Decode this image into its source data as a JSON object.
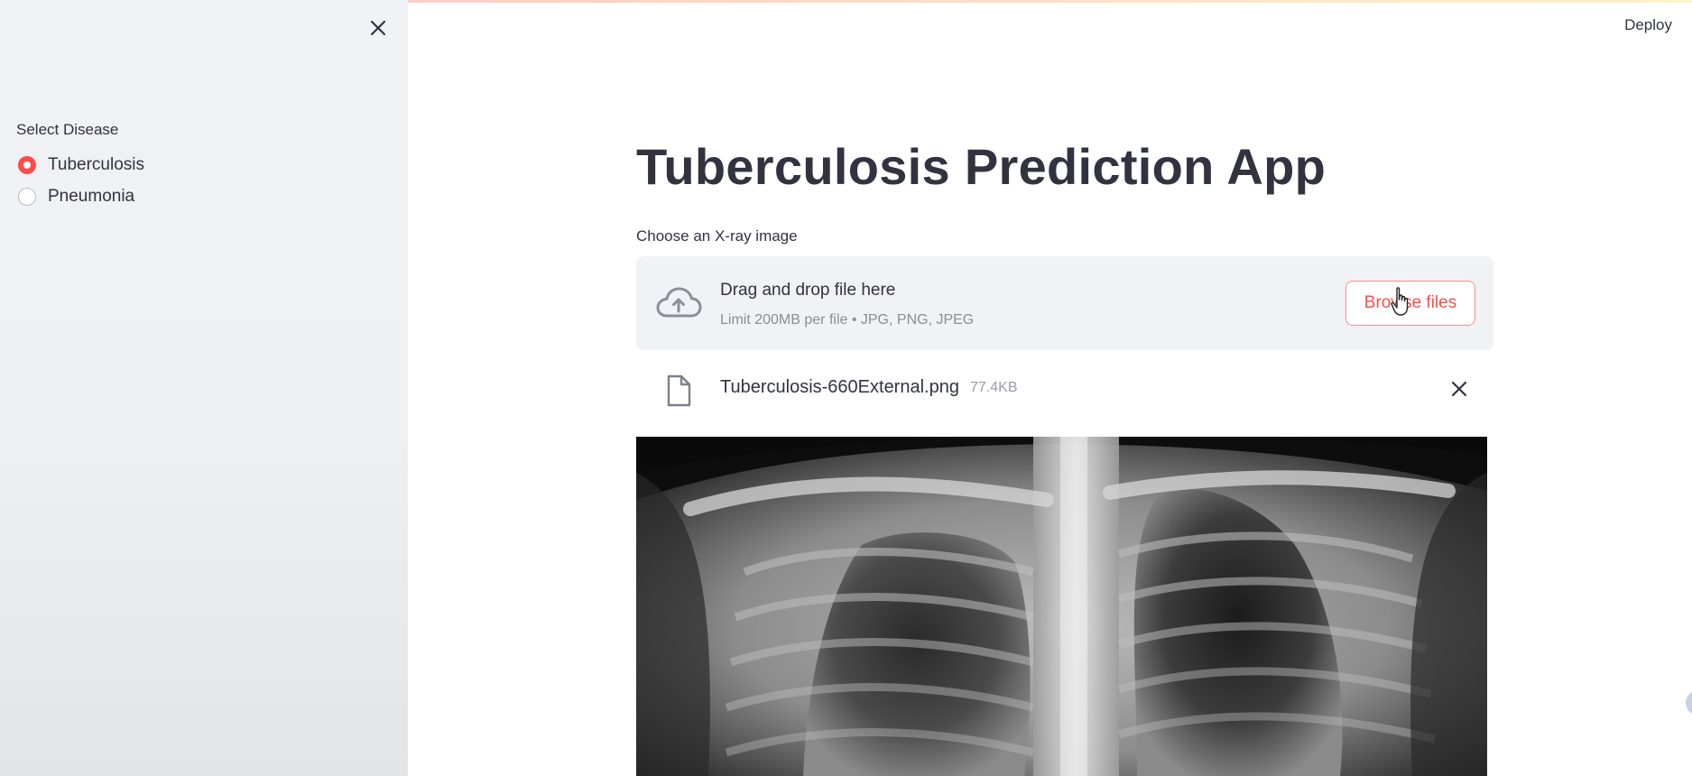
{
  "header": {
    "deploy_label": "Deploy"
  },
  "sidebar": {
    "close_icon": "close-icon",
    "radio_label": "Select Disease",
    "options": [
      {
        "label": "Tuberculosis",
        "selected": true
      },
      {
        "label": "Pneumonia",
        "selected": false
      }
    ],
    "accent_color": "#ff4b4b"
  },
  "main": {
    "title": "Tuberculosis Prediction App",
    "uploader": {
      "label": "Choose an X-ray image",
      "drop_title": "Drag and drop file here",
      "drop_subtitle": "Limit 200MB per file • JPG, PNG, JPEG",
      "browse_label": "Browse files",
      "upload_icon": "cloud-upload-icon"
    },
    "uploaded_file": {
      "name": "Tuberculosis-660External.png",
      "size": "77.4KB",
      "icon": "file-icon",
      "remove_icon": "close-icon"
    },
    "image": {
      "kind": "chest-x-ray"
    }
  }
}
